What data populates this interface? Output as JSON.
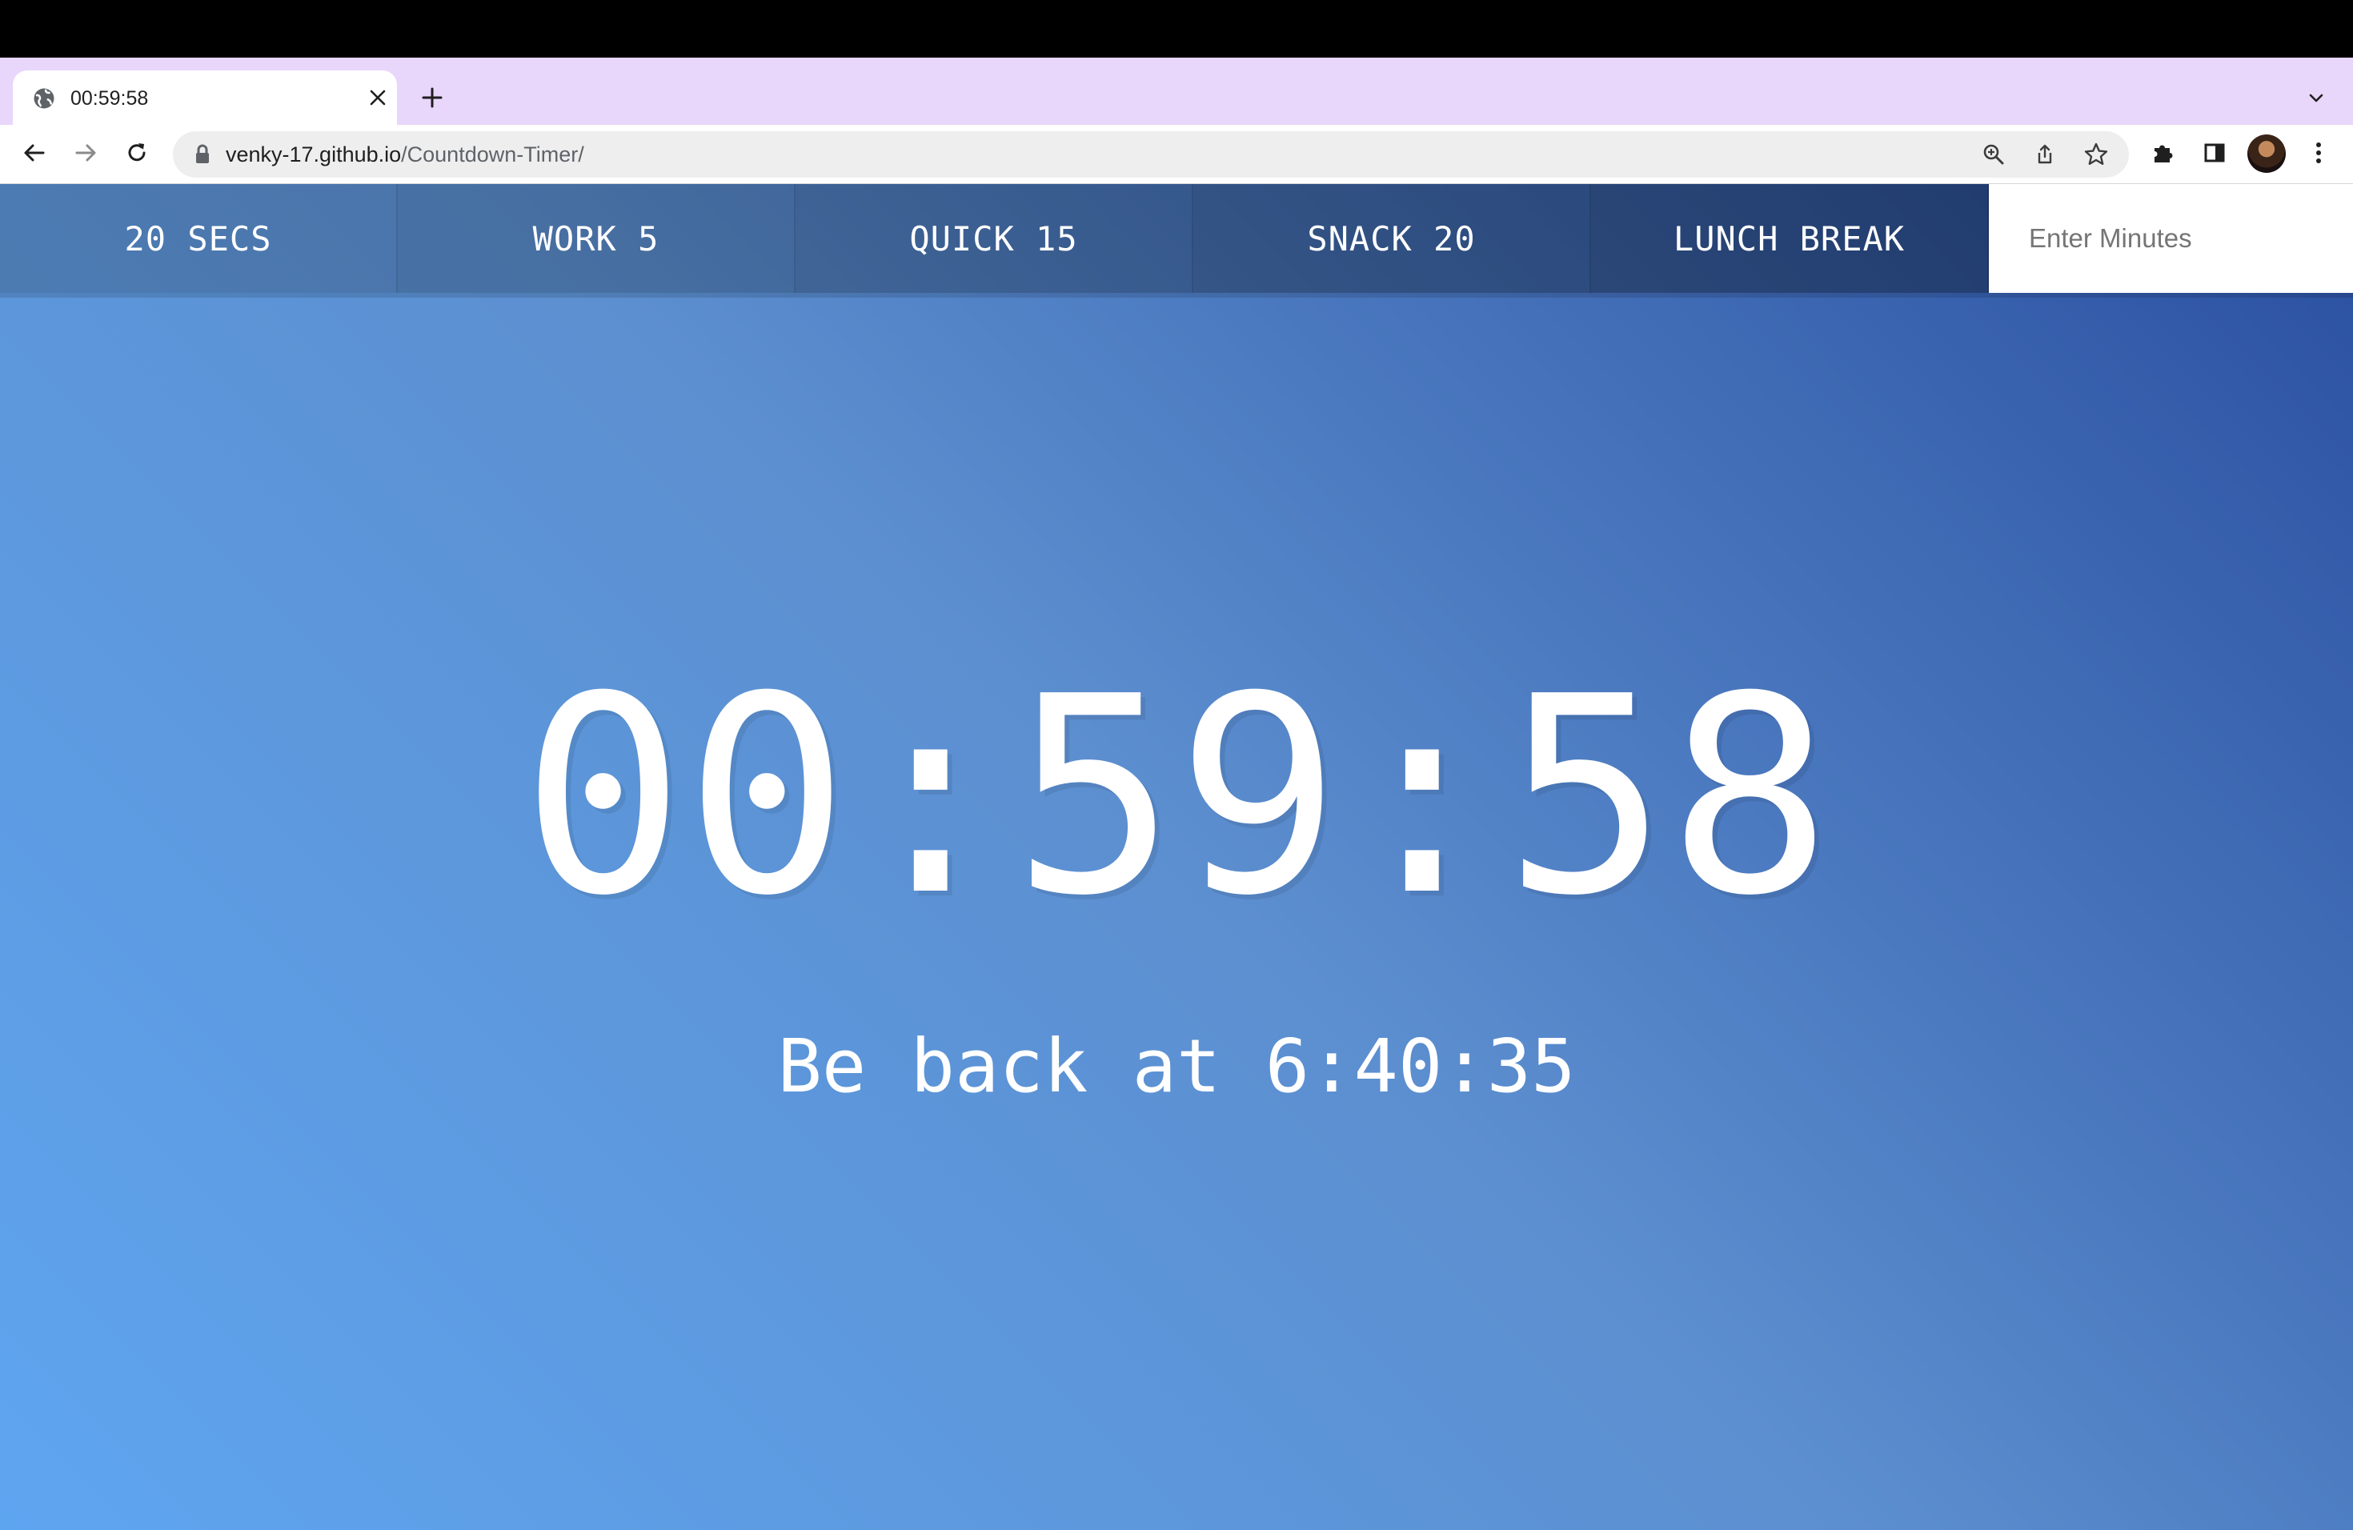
{
  "browser": {
    "tab": {
      "title": "00:59:58",
      "favicon": "globe-icon",
      "close_icon": "close-icon"
    },
    "new_tab_icon": "plus-icon",
    "tab_search_icon": "chevron-down-icon",
    "toolbar": {
      "back_icon": "arrow-left-icon",
      "forward_icon": "arrow-right-icon",
      "reload_icon": "reload-icon",
      "lock_icon": "lock-icon",
      "url_host": "venky-17.github.io",
      "url_path": "/Countdown-Timer/",
      "zoom_icon": "zoom-icon",
      "share_icon": "share-icon",
      "bookmark_icon": "star-icon",
      "extensions_icon": "puzzle-icon",
      "side_panel_icon": "side-panel-icon",
      "menu_icon": "kebab-menu-icon"
    }
  },
  "timer": {
    "buttons": [
      {
        "label": "20 SECS"
      },
      {
        "label": "WORK 5"
      },
      {
        "label": "QUICK 15"
      },
      {
        "label": "SNACK 20"
      },
      {
        "label": "LUNCH BREAK"
      }
    ],
    "custom_input": {
      "placeholder": "Enter Minutes",
      "value": ""
    },
    "time_left": "00:59:58",
    "end_time": "Be back at 6:40:35"
  },
  "colors": {
    "tabstrip": "#e8d6fb",
    "gradient_start": "#5ea5f0",
    "gradient_end": "#2a4fa0",
    "text": "#ffffff"
  }
}
